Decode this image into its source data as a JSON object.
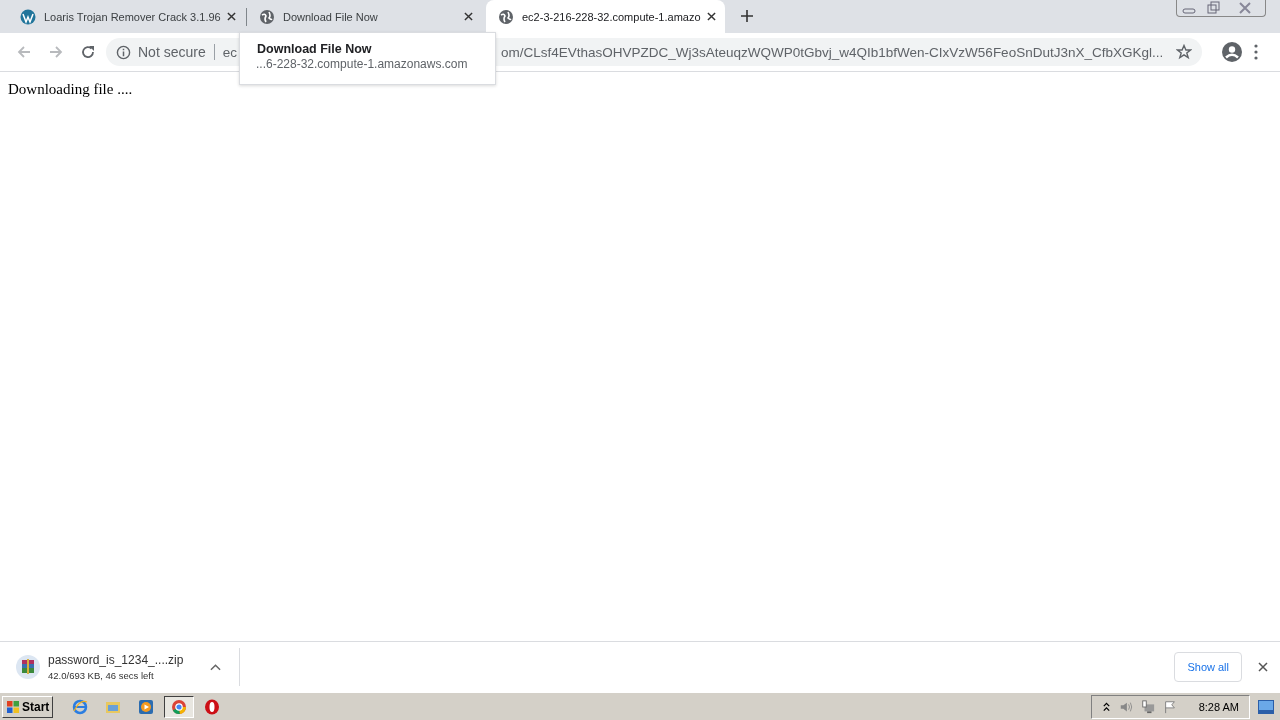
{
  "tabs": [
    {
      "title": "Loaris Trojan Remover Crack 3.1.96",
      "kind": "wordpress",
      "selected": false
    },
    {
      "title": "Download File Now",
      "kind": "globe",
      "selected": false
    },
    {
      "title": "ec2-3-216-228-32.compute-1.amazo",
      "kind": "globe",
      "selected": true
    }
  ],
  "address_bar": {
    "security": "Not secure",
    "url_start": "ec",
    "url_end": "om/CLsf4EVthasOHVPZDC_Wj3sAteuqzWQWP0tGbvj_w4QIb1bfWen-CIxVzW56FeoSnDutJ3nX_CfbXGKgl..."
  },
  "tooltip": {
    "title": "Download File Now",
    "subtitle": "...6-228-32.compute-1.amazonaws.com"
  },
  "page_text": "Downloading file ....",
  "download_bar": {
    "filename": "password_is_1234_....zip",
    "status": "42.0/693 KB, 46 secs left",
    "show_all": "Show all"
  },
  "taskbar": {
    "start": "Start",
    "apps": [
      {
        "kind": "ie",
        "selected": false
      },
      {
        "kind": "folder",
        "selected": false
      },
      {
        "kind": "media",
        "selected": false
      },
      {
        "kind": "chrome",
        "selected": true
      },
      {
        "kind": "opera",
        "selected": false
      }
    ],
    "clock": "8:28 AM"
  }
}
